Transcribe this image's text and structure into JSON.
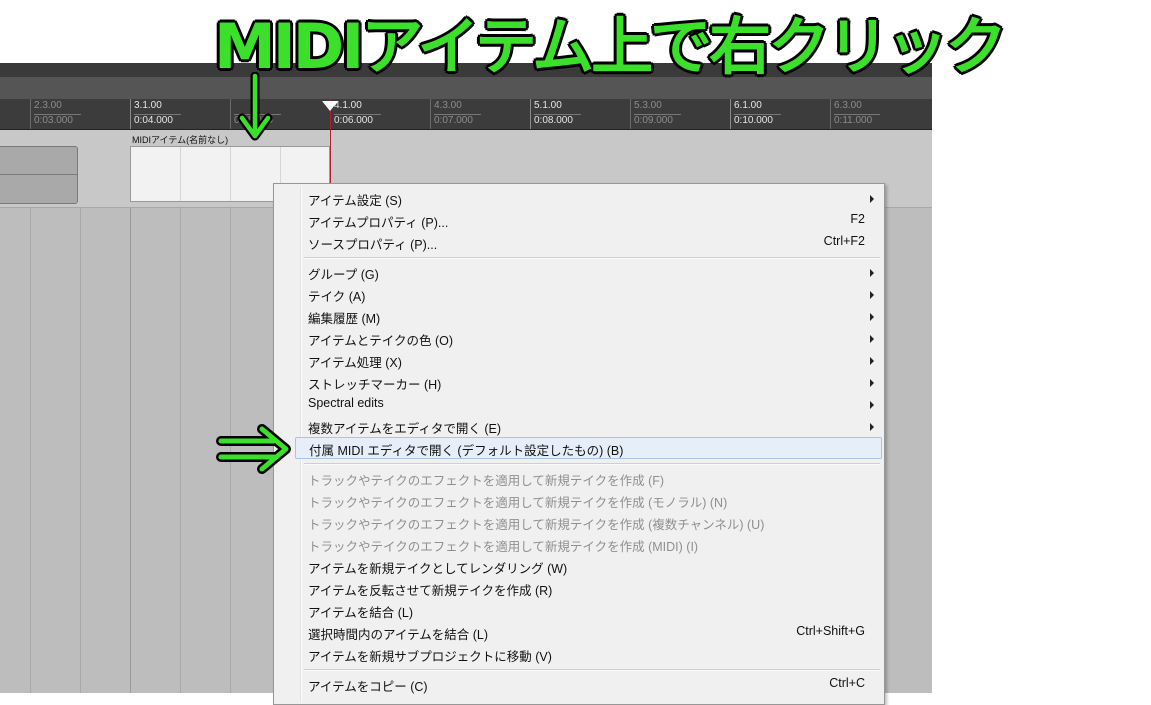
{
  "annotation": {
    "title": "MIDIアイテム上で右クリック",
    "color": "#3ae02a"
  },
  "ruler": {
    "ticks": [
      {
        "bar": "2.3.00",
        "time": "0:03.000",
        "minor": true
      },
      {
        "bar": "3.1.00",
        "time": "0:04.000",
        "minor": false
      },
      {
        "bar": "",
        "time": "0:05.000",
        "minor": true
      },
      {
        "bar": "4.1.00",
        "time": "0:06.000",
        "minor": false
      },
      {
        "bar": "4.3.00",
        "time": "0:07.000",
        "minor": true
      },
      {
        "bar": "5.1.00",
        "time": "0:08.000",
        "minor": false
      },
      {
        "bar": "5.3.00",
        "time": "0:09.000",
        "minor": true
      },
      {
        "bar": "6.1.00",
        "time": "0:10.000",
        "minor": false
      },
      {
        "bar": "6.3.00",
        "time": "0:11.000",
        "minor": true
      }
    ]
  },
  "midi_item": {
    "label": "MIDIアイテム(名前なし)"
  },
  "context_menu": {
    "group1": [
      {
        "label": "アイテム設定 (S)",
        "shortcut": "",
        "submenu": true
      },
      {
        "label": "アイテムプロパティ (P)...",
        "shortcut": "F2",
        "submenu": false
      },
      {
        "label": "ソースプロパティ (P)...",
        "shortcut": "Ctrl+F2",
        "submenu": false
      }
    ],
    "group2": [
      {
        "label": "グループ (G)",
        "shortcut": "",
        "submenu": true
      },
      {
        "label": "テイク (A)",
        "shortcut": "",
        "submenu": true
      },
      {
        "label": "編集履歴 (M)",
        "shortcut": "",
        "submenu": true
      },
      {
        "label": "アイテムとテイクの色 (O)",
        "shortcut": "",
        "submenu": true
      },
      {
        "label": "アイテム処理 (X)",
        "shortcut": "",
        "submenu": true
      },
      {
        "label": "ストレッチマーカー (H)",
        "shortcut": "",
        "submenu": true
      },
      {
        "label": "Spectral edits",
        "shortcut": "",
        "submenu": true
      },
      {
        "label": "複数アイテムをエディタで開く (E)",
        "shortcut": "",
        "submenu": true
      },
      {
        "label": "付属 MIDI エディタで開く (デフォルト設定したもの) (B)",
        "shortcut": "",
        "submenu": false
      }
    ],
    "group3": [
      {
        "label": "トラックやテイクのエフェクトを適用して新規テイクを作成 (F)",
        "shortcut": "",
        "disabled": true
      },
      {
        "label": "トラックやテイクのエフェクトを適用して新規テイクを作成 (モノラル) (N)",
        "shortcut": "",
        "disabled": true
      },
      {
        "label": "トラックやテイクのエフェクトを適用して新規テイクを作成 (複数チャンネル) (U)",
        "shortcut": "",
        "disabled": true
      },
      {
        "label": "トラックやテイクのエフェクトを適用して新規テイクを作成 (MIDI) (I)",
        "shortcut": "",
        "disabled": true
      },
      {
        "label": "アイテムを新規テイクとしてレンダリング (W)",
        "shortcut": "",
        "disabled": false
      },
      {
        "label": "アイテムを反転させて新規テイクを作成 (R)",
        "shortcut": "",
        "disabled": false
      },
      {
        "label": "アイテムを結合 (L)",
        "shortcut": "",
        "disabled": false
      },
      {
        "label": "選択時間内のアイテムを結合 (L)",
        "shortcut": "Ctrl+Shift+G",
        "disabled": false
      },
      {
        "label": "アイテムを新規サブプロジェクトに移動 (V)",
        "shortcut": "",
        "disabled": false
      }
    ],
    "group4": [
      {
        "label": "アイテムをコピー (C)",
        "shortcut": "Ctrl+C",
        "disabled": false
      }
    ]
  }
}
